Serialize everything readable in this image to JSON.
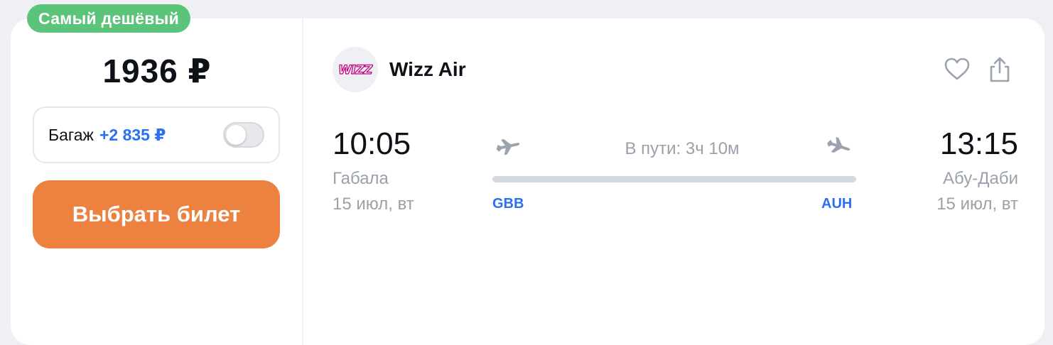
{
  "badge": "Самый дешёвый",
  "price": "1936 ₽",
  "baggage": {
    "label": "Багаж",
    "price": "+2 835 ₽",
    "enabled": false
  },
  "select_button": "Выбрать билет",
  "airline": {
    "name": "Wizz Air",
    "logo_text": "WIZZ",
    "logo_color": "#c6007e"
  },
  "actions": {
    "favorite_icon": "heart-icon",
    "share_icon": "share-icon"
  },
  "departure": {
    "time": "10:05",
    "city": "Габала",
    "date": "15 июл, вт",
    "iata": "GBB"
  },
  "arrival": {
    "time": "13:15",
    "city": "Абу-Даби",
    "date": "15 июл, вт",
    "iata": "AUH"
  },
  "duration": "В пути: 3ч 10м",
  "colors": {
    "badge": "#5cc37b",
    "button": "#ec8140",
    "accent_blue": "#2d6ff2",
    "muted_text": "#9aa1ab"
  }
}
